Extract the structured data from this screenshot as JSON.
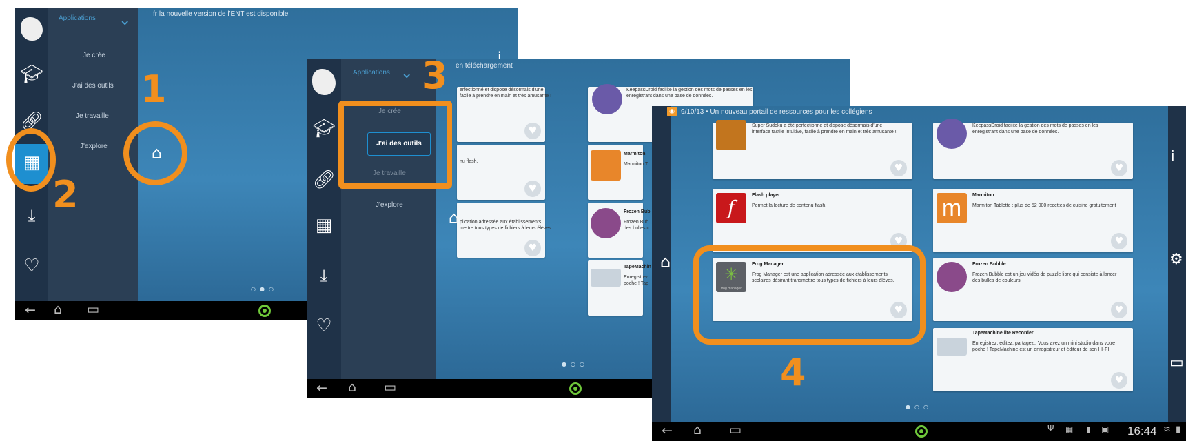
{
  "screen1": {
    "notification": "fr la nouvelle version de l'ENT est disponible",
    "menu_title": "Applications",
    "menu_items": [
      "Je crée",
      "J'ai des outils",
      "Je travaille",
      "J'explore"
    ]
  },
  "screen2": {
    "notification": "en téléchargement",
    "menu_title": "Applications",
    "menu_items": [
      "Je crée",
      "J'ai des outils",
      "Je travaille",
      "J'explore"
    ],
    "cards": {
      "c1_desc": "erfectionné et dispose désormais d'une\nfacile à prendre en main et très amusante !",
      "c2_desc": "nu flash.",
      "c3_desc": "plication adressée aux établissements\nmettre tous types de fichiers à leurs élèves.",
      "r1_desc": "KeepassDroid facilite la gestion des mots de passes en les\nenregistrant dans une base de données.",
      "r2_title": "Marmiton",
      "r2_desc": "Marmiton T",
      "r3_title": "Frozen Bub",
      "r3_desc": "Frozen Bub\ndes bulles c",
      "r4_title": "TapeMachin",
      "r4_desc": "Enregistrez\npoche ! Tap"
    }
  },
  "screen3": {
    "notification": "9/10/13 • Un nouveau portail de ressources pour les collégiens",
    "status_time": "16:44",
    "cards": [
      {
        "title": "",
        "desc": "Super Sudoku a été perfectionné et dispose désormais d'une\ninterface tactile intuitive, facile à prendre en main et très amusante !"
      },
      {
        "title": "",
        "desc": "KeepassDroid facilite la gestion des mots de passes en les\nenregistrant dans une base de données."
      },
      {
        "title": "Flash player",
        "desc": "Permet la lecture de contenu flash."
      },
      {
        "title": "Marmiton",
        "desc": "Marmiton Tablette : plus de 52 000 recettes de cuisine gratuitement !"
      },
      {
        "title": "Frog Manager",
        "desc": "Frog Manager est une application adressée aux établissements\nscolaires désirant transmettre tous types de fichiers à leurs élèves."
      },
      {
        "title": "Frozen Bubble",
        "desc": "Frozen Bubble est un jeu vidéo de puzzle libre qui consiste à lancer\ndes bulles de couleurs."
      },
      {
        "title": "TapeMachine lite Recorder",
        "desc": "Enregistrez, éditez, partagez.. Vous avez un mini studio dans votre\npoche ! TapeMachine est un enregistreur et éditeur de son HI-FI."
      }
    ],
    "frog_logo_text": "frog manager"
  },
  "annotations": [
    "1",
    "2",
    "3",
    "4"
  ],
  "colors": {
    "highlight": "#f18f1e",
    "accent": "#1e8fd0",
    "background": "#3d86b8",
    "sidebar": "#1f3248"
  }
}
